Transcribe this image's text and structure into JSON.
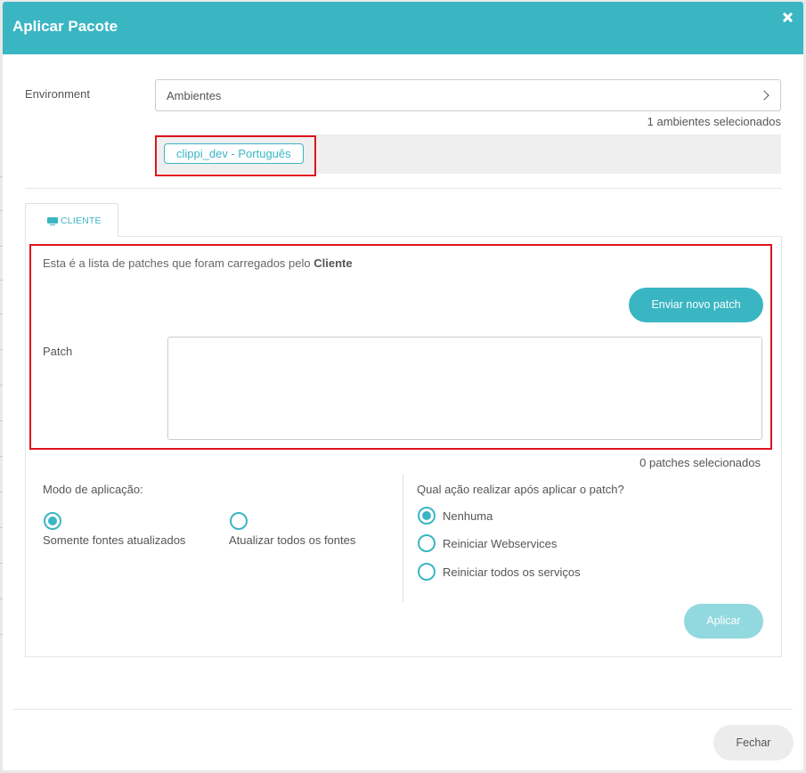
{
  "modal": {
    "title": "Aplicar Pacote",
    "close_icon": "close-icon"
  },
  "environment": {
    "label": "Environment",
    "select_value": "Ambientes",
    "selected_count": "1 ambientes selecionados",
    "chips": [
      "clippi_dev - Português"
    ]
  },
  "tabs": [
    {
      "label": "CLIENTE",
      "icon": "monitor-icon",
      "active": true
    }
  ],
  "client_panel": {
    "description_prefix": "Esta é a lista de patches que foram carregados pelo ",
    "description_bold": "Cliente",
    "send_button": "Enviar novo patch",
    "patch_label": "Patch",
    "patch_value": "",
    "patch_count": "0 patches selecionados"
  },
  "mode": {
    "title": "Modo de aplicação:",
    "options": [
      {
        "label": "Somente fontes atualizados",
        "checked": true
      },
      {
        "label": "Atualizar todos os fontes",
        "checked": false
      }
    ]
  },
  "post_action": {
    "title": "Qual ação realizar após aplicar o patch?",
    "options": [
      {
        "label": "Nenhuma",
        "checked": true
      },
      {
        "label": "Reiniciar Webservices",
        "checked": false
      },
      {
        "label": "Reiniciar todos os serviços",
        "checked": false
      }
    ]
  },
  "buttons": {
    "apply": "Aplicar",
    "close": "Fechar"
  },
  "colors": {
    "accent": "#3ab6c3",
    "accent_disabled": "#92d8df",
    "highlight": "#e0141e"
  }
}
